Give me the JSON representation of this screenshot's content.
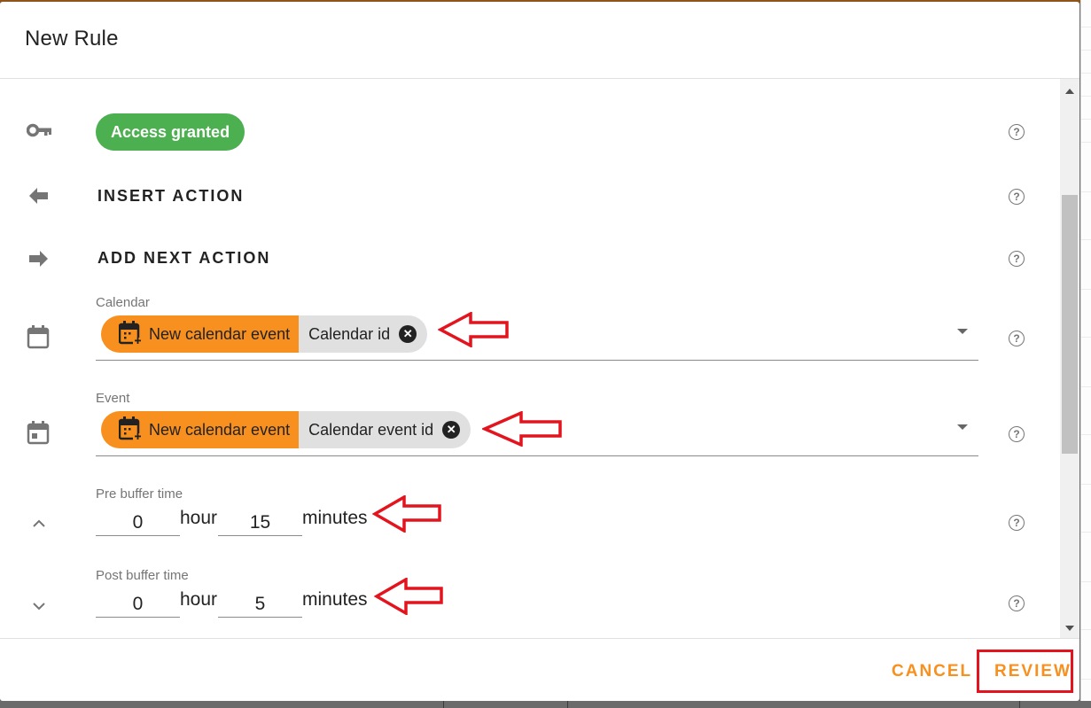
{
  "dialog": {
    "title": "New Rule"
  },
  "rows": {
    "access": {
      "icon": "key-icon",
      "badge_label": "Access granted",
      "badge_color": "#4caf50"
    },
    "insert_action": {
      "icon": "arrow-left-icon",
      "label": "INSERT ACTION"
    },
    "add_next_action": {
      "icon": "arrow-right-icon",
      "label": "ADD NEXT ACTION"
    },
    "calendar": {
      "icon": "calendar-icon",
      "label": "Calendar",
      "chip_source": "New calendar event",
      "chip_value": "Calendar id"
    },
    "event": {
      "icon": "calendar-event-icon",
      "label": "Event",
      "chip_source": "New calendar event",
      "chip_value": "Calendar event id"
    },
    "pre_buffer": {
      "icon": "chevron-up-icon",
      "label": "Pre buffer time",
      "hours": "0",
      "hour_unit": "hour",
      "minutes": "15",
      "minute_unit": "minutes"
    },
    "post_buffer": {
      "icon": "chevron-down-icon",
      "label": "Post buffer time",
      "hours": "0",
      "hour_unit": "hour",
      "minutes": "5",
      "minute_unit": "minutes"
    }
  },
  "help_glyph": "?",
  "chip_remove_glyph": "✕",
  "footer": {
    "cancel_label": "CANCEL",
    "review_label": "REVIEW"
  },
  "colors": {
    "accent": "#f7901e",
    "chip_value_bg": "#e0e0e0",
    "annotation": "#e3141d"
  }
}
